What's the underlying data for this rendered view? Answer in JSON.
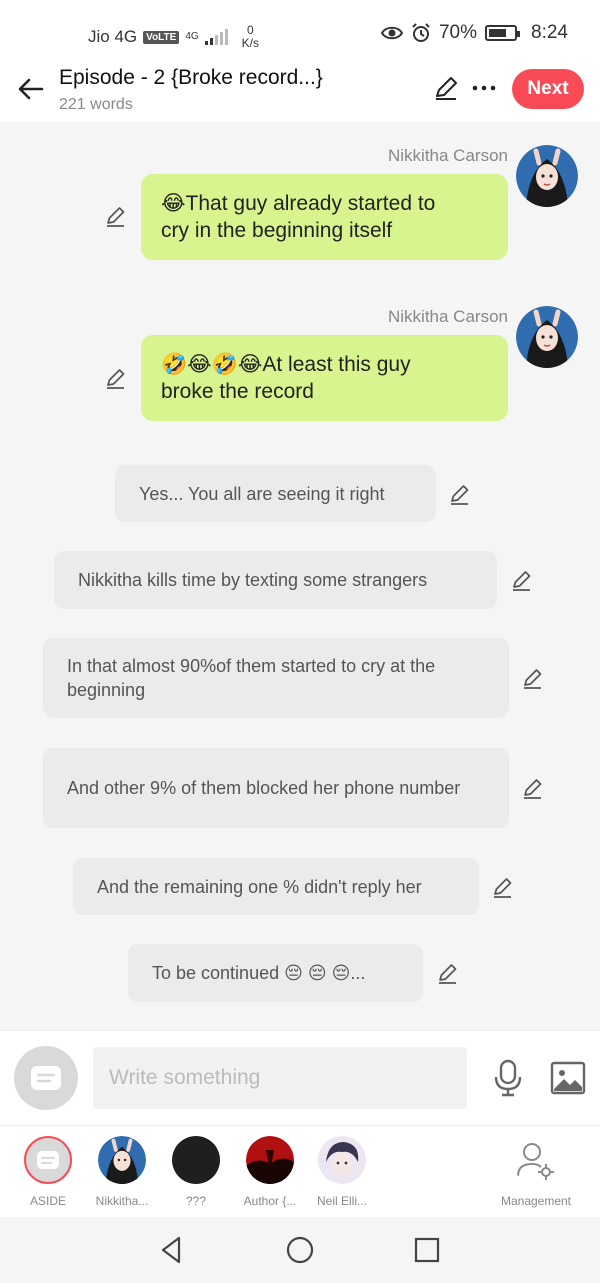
{
  "status_bar": {
    "carrier": "Jio 4G",
    "volte": "VoLTE",
    "net": "4G",
    "speed_value": "0",
    "speed_unit": "K/s",
    "battery": "70%",
    "battery_level": 0.7,
    "time": "8:24"
  },
  "header": {
    "title": "Episode - 2 {Broke record...}",
    "word_count": "221 words",
    "next_label": "Next"
  },
  "messages": [
    {
      "sender": "Nikkitha Carson",
      "text_line1": "😂That guy already started to",
      "text_line2": "cry in the beginning itself"
    },
    {
      "sender": "Nikkitha Carson",
      "text_line1": "🤣😂🤣😂At least this guy",
      "text_line2": "broke the record"
    }
  ],
  "narrations": [
    "Yes... You all are seeing it right",
    "Nikkitha kills time by texting some strangers",
    "In that almost 90%of them started to cry at the beginning",
    "And other 9% of them blocked her phone number",
    "And the remaining one %  didn't reply her",
    "To be continued 😔 😔 😔..."
  ],
  "input": {
    "placeholder": "Write something"
  },
  "characters": [
    {
      "label": "ASIDE"
    },
    {
      "label": "Nikkitha..."
    },
    {
      "label": "???"
    },
    {
      "label": "Author {..."
    },
    {
      "label": "Neil Elli..."
    },
    {
      "label": "Management"
    }
  ],
  "colors": {
    "accent": "#f94b56",
    "bubble_green": "#d7f48f",
    "bubble_grey": "#ebebeb"
  }
}
